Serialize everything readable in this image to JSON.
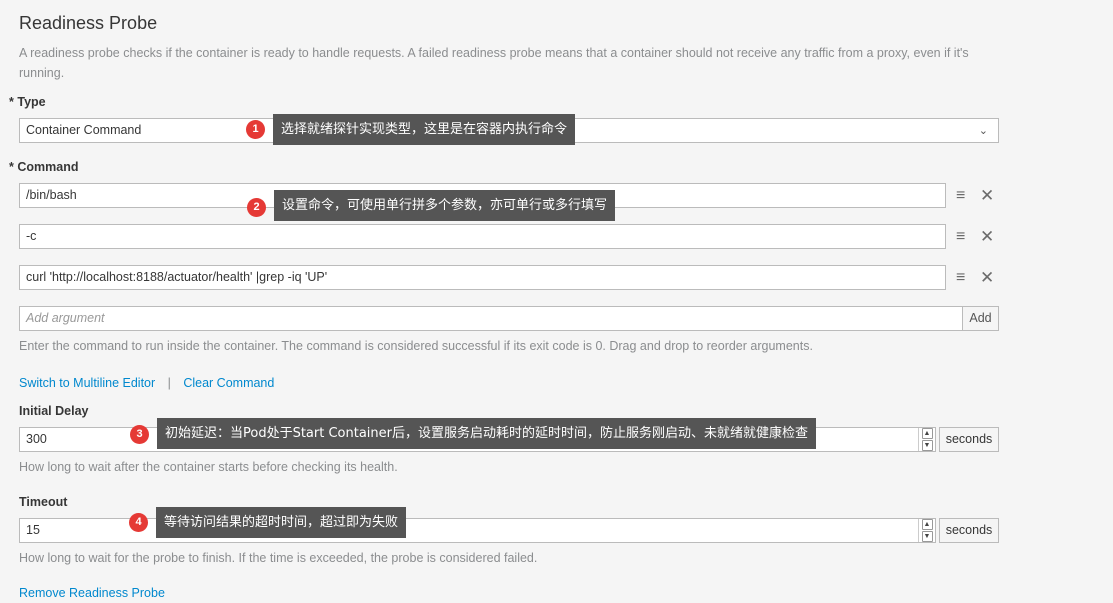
{
  "section": {
    "title": "Readiness Probe",
    "description": "A readiness probe checks if the container is ready to handle requests. A failed readiness probe means that a container should not receive any traffic from a proxy, even if it's running."
  },
  "type": {
    "required_mark": "*",
    "label": "Type",
    "value": "Container Command",
    "caret": "⌄"
  },
  "command": {
    "required_mark": "*",
    "label": "Command",
    "args": [
      "/bin/bash",
      "-c",
      "curl 'http://localhost:8188/actuator/health' |grep -iq 'UP'"
    ],
    "drag_icon": "≡",
    "remove_icon": "✕",
    "add_placeholder": "Add argument",
    "add_label": "Add",
    "help": "Enter the command to run inside the container. The command is considered successful if its exit code is 0. Drag and drop to reorder arguments.",
    "switch_link": "Switch to Multiline Editor",
    "separator": "|",
    "clear_link": "Clear Command"
  },
  "initial_delay": {
    "label": "Initial Delay",
    "value": "300",
    "unit": "seconds",
    "help": "How long to wait after the container starts before checking its health."
  },
  "timeout": {
    "label": "Timeout",
    "value": "15",
    "unit": "seconds",
    "help": "How long to wait for the probe to finish. If the time is exceeded, the probe is considered failed."
  },
  "remove_link": "Remove Readiness Probe",
  "annotations": [
    {
      "number": "1",
      "text": "选择就绪探针实现类型，这里是在容器内执行命令"
    },
    {
      "number": "2",
      "text": "设置命令，可使用单行拼多个参数，亦可单行或多行填写"
    },
    {
      "number": "3",
      "text": "初始延迟：当Pod处于Start Container后，设置服务启动耗时的延时时间，防止服务刚启动、未就绪就健康检查"
    },
    {
      "number": "4",
      "text": "等待访问结果的超时时间，超过即为失败"
    }
  ]
}
